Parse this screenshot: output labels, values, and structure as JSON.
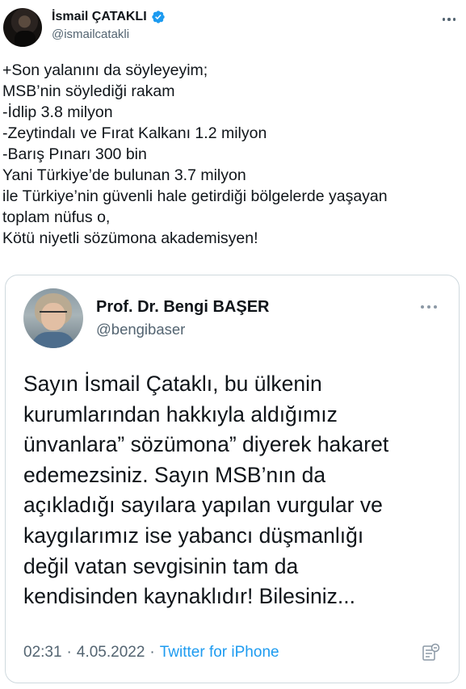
{
  "author": {
    "display_name": "İsmail ÇATAKLI",
    "handle": "@ismailcatakli",
    "verified": true
  },
  "tweet_lines": [
    "+Son yalanını da söyleyeyim;",
    "MSB’nin söylediği rakam",
    "-İdlip 3.8 milyon",
    "-Zeytindalı ve Fırat Kalkanı 1.2 milyon",
    "-Barış Pınarı 300 bin",
    "Yani Türkiye’de bulunan 3.7 milyon",
    "ile Türkiye’nin güvenli hale getirdiği bölgelerde yaşayan",
    "toplam nüfus o,",
    "Kötü niyetli sözümona akademisyen!"
  ],
  "quoted": {
    "display_name": "Prof. Dr. Bengi BAŞER",
    "handle": "@bengibaser",
    "lines": [
      "Sayın İsmail Çataklı, bu ülkenin",
      "kurumlarından hakkıyla aldığımız",
      "ünvanlara” sözümona” diyerek hakaret",
      "edemezsiniz. Sayın MSB’nın da",
      "açıkladığı sayılara yapılan vurgular ve",
      "kaygılarımız ise yabancı düşmanlığı",
      "değil vatan sevgisinin tam da",
      "kendisinden kaynaklıdır! Bilesiniz..."
    ],
    "time": "02:31",
    "separator": "·",
    "date": "4.05.2022",
    "source": "Twitter for iPhone"
  },
  "colors": {
    "verified": "#1d9bf0",
    "link": "#1d9bf0",
    "secondary_text": "#536471",
    "border": "#cfd9de"
  },
  "icons": {
    "verified": "verified-badge-icon",
    "more": "more-options-icon",
    "analytics": "tweet-analytics-icon"
  }
}
